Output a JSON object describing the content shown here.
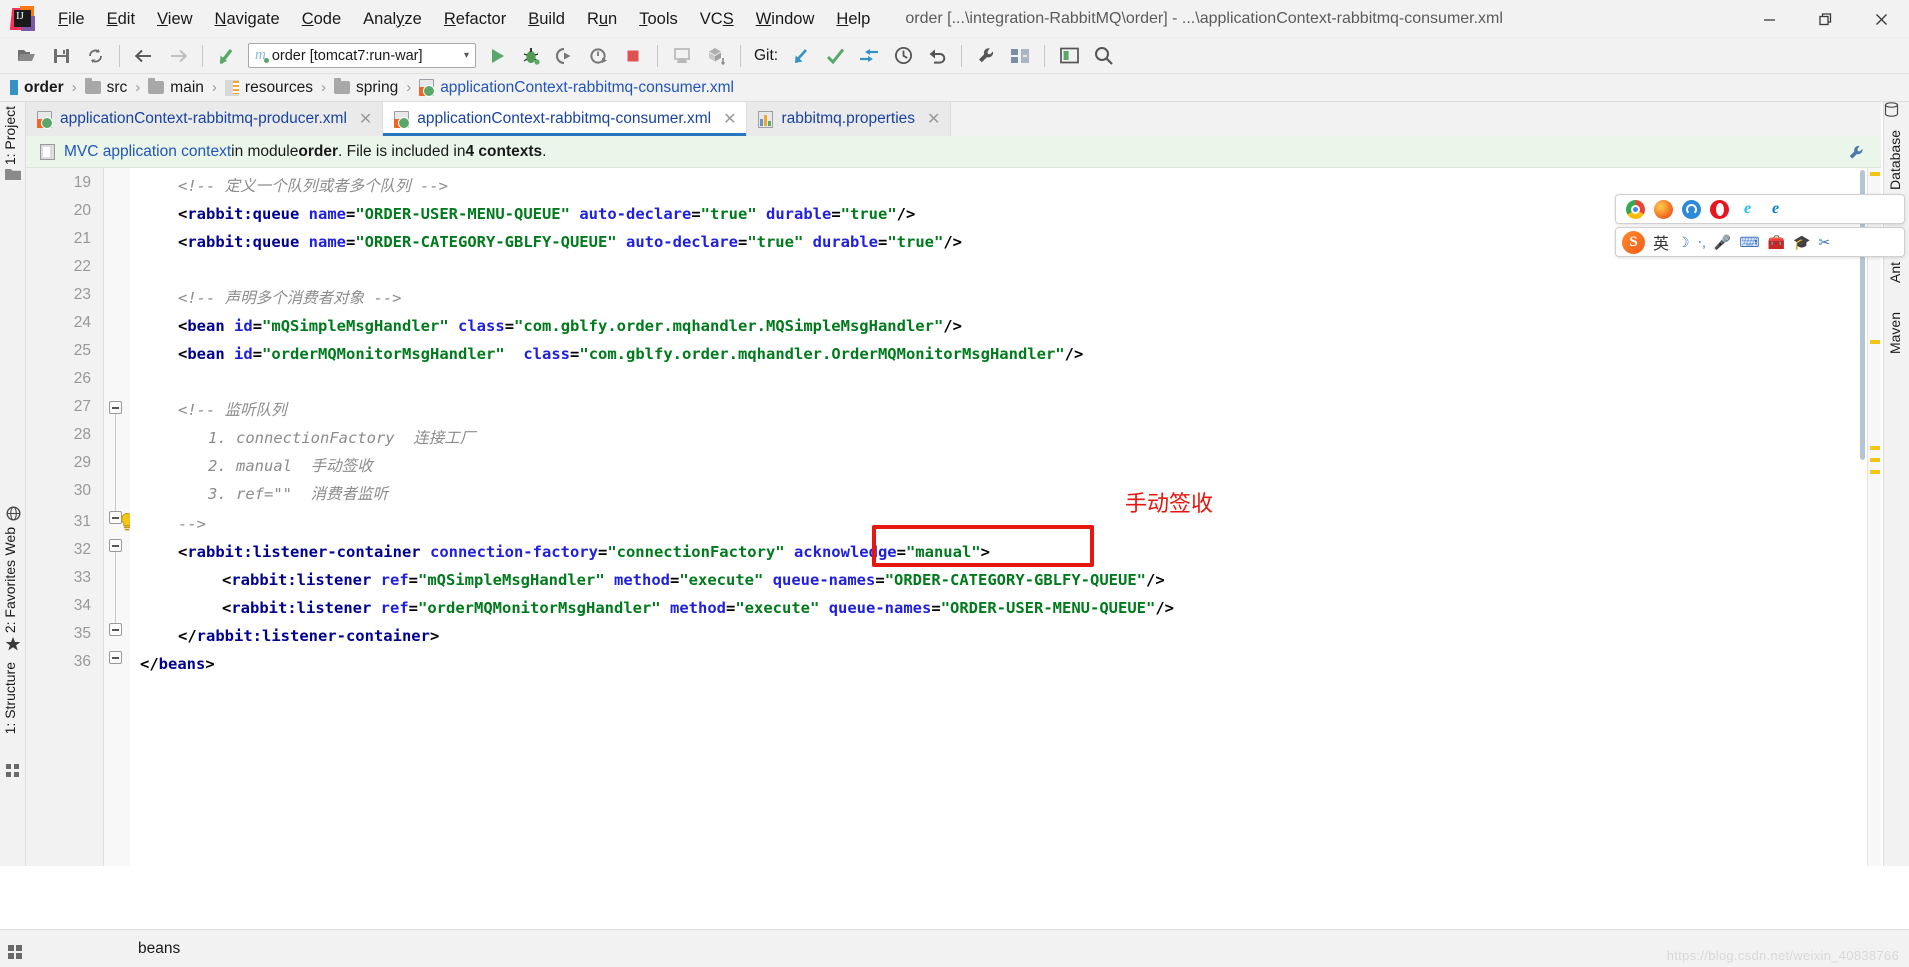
{
  "window": {
    "title": "order [...\\integration-RabbitMQ\\order] - ...\\applicationContext-rabbitmq-consumer.xml",
    "minimize_label": "—",
    "restore_label": "❐",
    "close_label": "✕",
    "app_icon": "intellij-idea-logo"
  },
  "menubar": {
    "items": [
      {
        "label": "File",
        "mnemonic": "F"
      },
      {
        "label": "Edit",
        "mnemonic": "E"
      },
      {
        "label": "View",
        "mnemonic": "V"
      },
      {
        "label": "Navigate",
        "mnemonic": "N"
      },
      {
        "label": "Code",
        "mnemonic": "C"
      },
      {
        "label": "Analyze",
        "mnemonic": "y"
      },
      {
        "label": "Refactor",
        "mnemonic": "R"
      },
      {
        "label": "Build",
        "mnemonic": "B"
      },
      {
        "label": "Run",
        "mnemonic": "u"
      },
      {
        "label": "Tools",
        "mnemonic": "T"
      },
      {
        "label": "VCS",
        "mnemonic": "S"
      },
      {
        "label": "Window",
        "mnemonic": "W"
      },
      {
        "label": "Help",
        "mnemonic": "H"
      }
    ]
  },
  "toolbar": {
    "open_icon": "open-folder-icon",
    "save_icon": "save-icon",
    "sync_icon": "sync-icon",
    "back_icon": "back-arrow-icon",
    "forward_icon": "forward-arrow-icon",
    "jump_icon": "jump-to-source-icon",
    "run_config": {
      "label": "order [tomcat7:run-war]",
      "module_icon": "maven-m-icon",
      "chevron": "▾"
    },
    "run_icon": "run-icon",
    "debug_icon": "debug-icon",
    "run_coverage_icon": "run-with-coverage-icon",
    "profile_icon": "profile-icon",
    "stop_icon": "stop-icon",
    "android_icon": "android-device-icon",
    "sync_gradle_icon": "sync-project-icon",
    "git_label": "Git:",
    "git_update_icon": "update-project-icon",
    "git_commit_icon": "commit-icon",
    "git_push_icon": "push-icon",
    "git_history_icon": "history-icon",
    "git_rollback_icon": "rollback-icon",
    "settings_icon": "settings-wrench-icon",
    "structure_icon": "project-structure-icon",
    "layout_icon": "layout-icon",
    "search_icon": "search-everywhere-icon"
  },
  "breadcrumb": {
    "items": [
      {
        "label": "order",
        "icon": "project-icon",
        "style": "bold"
      },
      {
        "label": "src",
        "icon": "folder-icon",
        "style": "normal"
      },
      {
        "label": "main",
        "icon": "folder-icon",
        "style": "normal"
      },
      {
        "label": "resources",
        "icon": "resources-icon",
        "style": "normal"
      },
      {
        "label": "spring",
        "icon": "folder-icon",
        "style": "normal"
      },
      {
        "label": "applicationContext-rabbitmq-consumer.xml",
        "icon": "xml-file-icon",
        "style": "link"
      }
    ],
    "separator": "›"
  },
  "editor_tabs": [
    {
      "label": "applicationContext-rabbitmq-producer.xml",
      "icon": "spring-xml-icon",
      "active": false,
      "close": "✕"
    },
    {
      "label": "applicationContext-rabbitmq-consumer.xml",
      "icon": "spring-xml-icon",
      "active": true,
      "close": "✕"
    },
    {
      "label": "rabbitmq.properties",
      "icon": "properties-icon",
      "active": false,
      "close": "✕"
    }
  ],
  "notification": {
    "icon": "context-icon",
    "link_text": "MVC application context",
    "text_mid": " in module ",
    "module": "order",
    "text_after": ". File is included in ",
    "contexts": "4 contexts",
    "period": ".",
    "configure_icon": "wrench-icon"
  },
  "left_tool_windows": [
    {
      "label": "1: Project",
      "icon": "project-tool-icon"
    },
    {
      "label": "Web",
      "icon": "web-tool-icon"
    },
    {
      "label": "2: Favorites",
      "icon": "favorites-star-icon"
    },
    {
      "label": "1: Structure",
      "icon": "structure-tool-icon"
    }
  ],
  "right_tool_windows": [
    {
      "label": "Database",
      "icon": "database-tool-icon"
    },
    {
      "label": "Maven",
      "icon": "maven-tool-icon"
    },
    {
      "label": "Ant",
      "icon": "ant-tool-icon"
    }
  ],
  "editor": {
    "first_line_number": 19,
    "caret_line": 31,
    "lines": [
      {
        "n": 19,
        "indent": 1,
        "type": "comment",
        "text": "<!-- 定义一个队列或者多个队列 -->"
      },
      {
        "n": 20,
        "indent": 1,
        "type": "code",
        "tokens": [
          [
            "pun",
            "<"
          ],
          [
            "tag",
            "rabbit:queue"
          ],
          [
            "pun",
            " "
          ],
          [
            "attr",
            "name"
          ],
          [
            "pun",
            "="
          ],
          [
            "val",
            "\"ORDER-USER-MENU-QUEUE\""
          ],
          [
            "pun",
            " "
          ],
          [
            "attr",
            "auto-declare"
          ],
          [
            "pun",
            "="
          ],
          [
            "val",
            "\"true\""
          ],
          [
            "pun",
            " "
          ],
          [
            "attr",
            "durable"
          ],
          [
            "pun",
            "="
          ],
          [
            "val",
            "\"true\""
          ],
          [
            "pun",
            "/>"
          ]
        ]
      },
      {
        "n": 21,
        "indent": 1,
        "type": "code",
        "tokens": [
          [
            "pun",
            "<"
          ],
          [
            "tag",
            "rabbit:queue"
          ],
          [
            "pun",
            " "
          ],
          [
            "attr",
            "name"
          ],
          [
            "pun",
            "="
          ],
          [
            "val",
            "\"ORDER-CATEGORY-GBLFY-QUEUE\""
          ],
          [
            "pun",
            " "
          ],
          [
            "attr",
            "auto-declare"
          ],
          [
            "pun",
            "="
          ],
          [
            "val",
            "\"true\""
          ],
          [
            "pun",
            " "
          ],
          [
            "attr",
            "durable"
          ],
          [
            "pun",
            "="
          ],
          [
            "val",
            "\"true\""
          ],
          [
            "pun",
            "/>"
          ]
        ]
      },
      {
        "n": 22,
        "indent": 0,
        "type": "blank",
        "text": ""
      },
      {
        "n": 23,
        "indent": 1,
        "type": "comment",
        "text": "<!-- 声明多个消费者对象 -->"
      },
      {
        "n": 24,
        "indent": 1,
        "type": "code",
        "tokens": [
          [
            "pun",
            "<"
          ],
          [
            "tag",
            "bean"
          ],
          [
            "pun",
            " "
          ],
          [
            "attr",
            "id"
          ],
          [
            "pun",
            "="
          ],
          [
            "val",
            "\"mQSimpleMsgHandler\""
          ],
          [
            "pun",
            " "
          ],
          [
            "attr",
            "class"
          ],
          [
            "pun",
            "="
          ],
          [
            "val",
            "\"com.gblfy.order.mqhandler.MQSimpleMsgHandler\""
          ],
          [
            "pun",
            "/>"
          ]
        ]
      },
      {
        "n": 25,
        "indent": 1,
        "type": "code",
        "tokens": [
          [
            "pun",
            "<"
          ],
          [
            "tag",
            "bean"
          ],
          [
            "pun",
            " "
          ],
          [
            "attr",
            "id"
          ],
          [
            "pun",
            "="
          ],
          [
            "val",
            "\"orderMQMonitorMsgHandler\""
          ],
          [
            "pun",
            " "
          ],
          [
            "attr",
            "class"
          ],
          [
            "pun",
            "="
          ],
          [
            "val",
            "\"com.gblfy.order.mqhandler.OrderMQMonitorMsgHandler\""
          ],
          [
            "pun",
            "/>"
          ]
        ]
      },
      {
        "n": 26,
        "indent": 0,
        "type": "blank",
        "text": ""
      },
      {
        "n": 27,
        "indent": 1,
        "type": "comment",
        "text": "<!-- 监听队列"
      },
      {
        "n": 28,
        "indent": 2,
        "type": "comment",
        "text": "1. connectionFactory  连接工厂"
      },
      {
        "n": 29,
        "indent": 2,
        "type": "comment",
        "text": "2. manual  手动签收"
      },
      {
        "n": 30,
        "indent": 2,
        "type": "comment",
        "text": "3. ref=\"\"  消费者监听"
      },
      {
        "n": 31,
        "indent": 1,
        "type": "comment",
        "text": "-->"
      },
      {
        "n": 32,
        "indent": 1,
        "type": "code",
        "tokens": [
          [
            "pun",
            "<"
          ],
          [
            "tag",
            "rabbit:listener-container"
          ],
          [
            "pun",
            " "
          ],
          [
            "attr",
            "connection-factory"
          ],
          [
            "pun",
            "="
          ],
          [
            "val",
            "\"connectionFactory\""
          ],
          [
            "pun",
            " "
          ],
          [
            "attr",
            "acknowledge"
          ],
          [
            "pun",
            "="
          ],
          [
            "val",
            "\"manual\""
          ],
          [
            "pun",
            ">"
          ]
        ]
      },
      {
        "n": 33,
        "indent": 2,
        "type": "code",
        "tokens": [
          [
            "pun",
            "<"
          ],
          [
            "tag",
            "rabbit:listener"
          ],
          [
            "pun",
            " "
          ],
          [
            "attr",
            "ref"
          ],
          [
            "pun",
            "="
          ],
          [
            "val",
            "\"mQSimpleMsgHandler\""
          ],
          [
            "pun",
            " "
          ],
          [
            "attr",
            "method"
          ],
          [
            "pun",
            "="
          ],
          [
            "val",
            "\"execute\""
          ],
          [
            "pun",
            " "
          ],
          [
            "attr",
            "queue-names"
          ],
          [
            "pun",
            "="
          ],
          [
            "val",
            "\"ORDER-CATEGORY-GBLFY-QUEUE\""
          ],
          [
            "pun",
            "/>"
          ]
        ]
      },
      {
        "n": 34,
        "indent": 2,
        "type": "code",
        "tokens": [
          [
            "pun",
            "<"
          ],
          [
            "tag",
            "rabbit:listener"
          ],
          [
            "pun",
            " "
          ],
          [
            "attr",
            "ref"
          ],
          [
            "pun",
            "="
          ],
          [
            "val",
            "\"orderMQMonitorMsgHandler\""
          ],
          [
            "pun",
            " "
          ],
          [
            "attr",
            "method"
          ],
          [
            "pun",
            "="
          ],
          [
            "val",
            "\"execute\""
          ],
          [
            "pun",
            " "
          ],
          [
            "attr",
            "queue-names"
          ],
          [
            "pun",
            "="
          ],
          [
            "val",
            "\"ORDER-USER-MENU-QUEUE\""
          ],
          [
            "pun",
            "/>"
          ]
        ]
      },
      {
        "n": 35,
        "indent": 1,
        "type": "code",
        "tokens": [
          [
            "pun",
            "</"
          ],
          [
            "tag",
            "rabbit:listener-container"
          ],
          [
            "pun",
            ">"
          ]
        ]
      },
      {
        "n": 36,
        "indent": 0,
        "type": "code",
        "tokens": [
          [
            "pun",
            "</"
          ],
          [
            "tag",
            "beans"
          ],
          [
            "pun",
            ">"
          ]
        ]
      }
    ],
    "intention_bulb_icon": "intention-bulb-icon"
  },
  "annotation": {
    "text": "手动签收",
    "color": "#e61610",
    "highlight_target": "acknowledge=\"manual\""
  },
  "ime": {
    "browsers": [
      "chrome-icon",
      "firefox-icon",
      "edge-legacy-icon",
      "opera-icon",
      "ie-icon",
      "edge-icon"
    ],
    "logo": "S",
    "mode_label": "英",
    "icons": [
      "moon-icon",
      "emoji-icon",
      "mic-icon",
      "keyboard-icon",
      "toolbox-icon",
      "hat-icon",
      "scissors-icon"
    ]
  },
  "statusbar": {
    "breadcrumb_text": "beans",
    "watermark": "https://blog.csdn.net/weixin_40838766",
    "layout_icon": "layout-grid-icon"
  },
  "colors": {
    "accent": "#2675bf",
    "tag": "#000091",
    "attribute": "#2020dd",
    "value": "#007a1c",
    "comment": "#8c8c8c",
    "annotation_red": "#e61610",
    "caret_line": "#fdf8e3",
    "notification_bg": "#eaf6ea",
    "link": "#2255bb"
  }
}
